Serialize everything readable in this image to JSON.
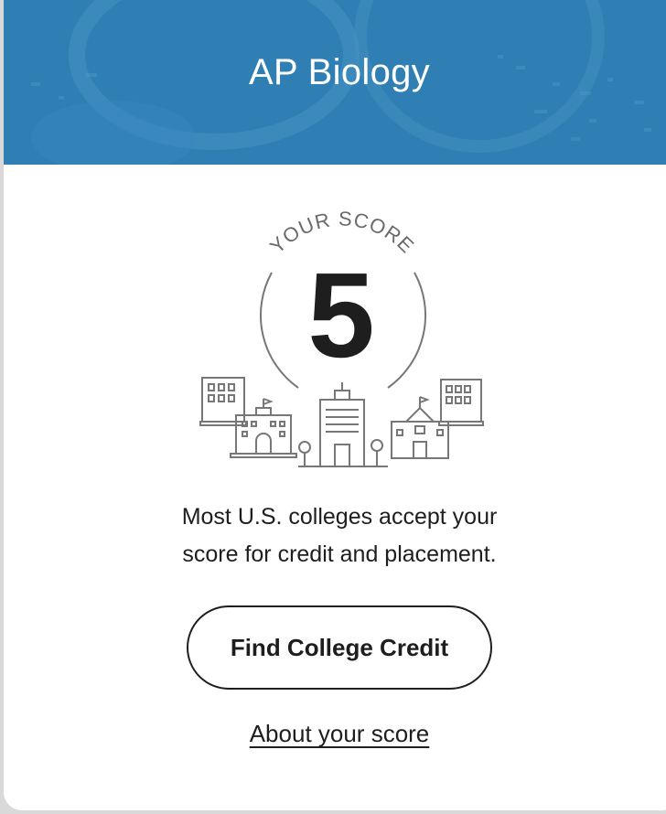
{
  "header": {
    "title": "AP Biology",
    "background_color": "#2f7fb4"
  },
  "score": {
    "label": "YOUR SCORE",
    "value": "5"
  },
  "message": {
    "line1": "Most U.S. colleges accept your",
    "line2": "score for credit and placement."
  },
  "actions": {
    "primary_button": "Find College Credit",
    "secondary_link": "About your score"
  }
}
